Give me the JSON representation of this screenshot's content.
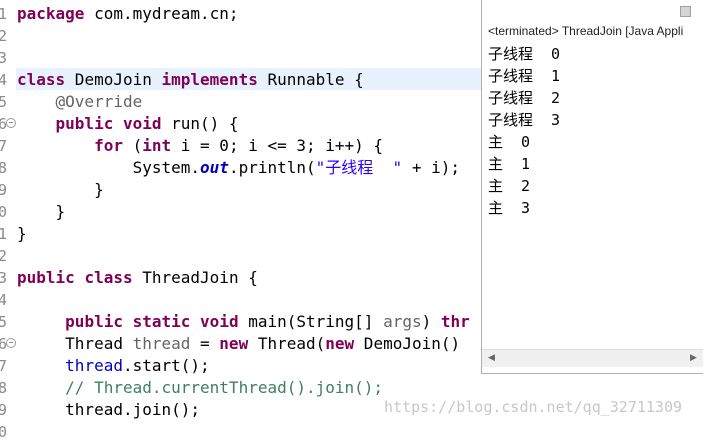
{
  "editor": {
    "line_numbers": [
      "1",
      "2",
      "3",
      "4",
      "5",
      "6",
      "7",
      "8",
      "9",
      "0",
      "1",
      "2",
      "3",
      "4",
      "5",
      "6",
      "7",
      "8",
      "9",
      "0"
    ],
    "lines": [
      [
        {
          "t": "package",
          "c": "kw"
        },
        {
          "t": " com.mydream.cn;",
          "c": ""
        }
      ],
      [],
      [],
      [
        {
          "t": "class",
          "c": "kw"
        },
        {
          "t": " DemoJoin ",
          "c": ""
        },
        {
          "t": "implements",
          "c": "kw"
        },
        {
          "t": " Runnable {",
          "c": ""
        }
      ],
      [
        {
          "t": "    @Override",
          "c": "ann"
        }
      ],
      [
        {
          "t": "    ",
          "c": ""
        },
        {
          "t": "public",
          "c": "kw"
        },
        {
          "t": " ",
          "c": ""
        },
        {
          "t": "void",
          "c": "kw"
        },
        {
          "t": " run() {",
          "c": ""
        }
      ],
      [
        {
          "t": "        ",
          "c": ""
        },
        {
          "t": "for",
          "c": "kw"
        },
        {
          "t": " (",
          "c": ""
        },
        {
          "t": "int",
          "c": "kw"
        },
        {
          "t": " i = 0; i <= 3; i++) {",
          "c": ""
        }
      ],
      [
        {
          "t": "            System.",
          "c": ""
        },
        {
          "t": "out",
          "c": "fld"
        },
        {
          "t": ".println(",
          "c": ""
        },
        {
          "t": "\"子线程  \"",
          "c": "str"
        },
        {
          "t": " + i);",
          "c": ""
        }
      ],
      [
        {
          "t": "        }",
          "c": ""
        }
      ],
      [
        {
          "t": "    }",
          "c": ""
        }
      ],
      [
        {
          "t": "}",
          "c": ""
        }
      ],
      [],
      [
        {
          "t": "public",
          "c": "kw"
        },
        {
          "t": " ",
          "c": ""
        },
        {
          "t": "class",
          "c": "kw"
        },
        {
          "t": " ThreadJoin {",
          "c": ""
        }
      ],
      [],
      [
        {
          "t": "     ",
          "c": ""
        },
        {
          "t": "public",
          "c": "kw"
        },
        {
          "t": " ",
          "c": ""
        },
        {
          "t": "static",
          "c": "kw"
        },
        {
          "t": " ",
          "c": ""
        },
        {
          "t": "void",
          "c": "kw"
        },
        {
          "t": " main(String[] ",
          "c": ""
        },
        {
          "t": "args",
          "c": "ann"
        },
        {
          "t": ") ",
          "c": ""
        },
        {
          "t": "thr",
          "c": "kw"
        }
      ],
      [
        {
          "t": "     Thread ",
          "c": ""
        },
        {
          "t": "thread",
          "c": "ann"
        },
        {
          "t": " = ",
          "c": ""
        },
        {
          "t": "new",
          "c": "kw"
        },
        {
          "t": " Thread(",
          "c": ""
        },
        {
          "t": "new",
          "c": "kw"
        },
        {
          "t": " DemoJoin()",
          "c": ""
        }
      ],
      [
        {
          "t": "     ",
          "c": ""
        },
        {
          "t": "thread",
          "c": "var"
        },
        {
          "t": ".start();",
          "c": ""
        }
      ],
      [
        {
          "t": "     ",
          "c": ""
        },
        {
          "t": "// Thread.currentThread().join();",
          "c": "cmt"
        }
      ],
      [
        {
          "t": "     thread.join();",
          "c": ""
        }
      ]
    ],
    "watermark": "https://blog.csdn.net/qq_32711309"
  },
  "console": {
    "title": "<terminated> ThreadJoin [Java Appli",
    "output": [
      "子线程  0",
      "子线程  1",
      "子线程  2",
      "子线程  3",
      "主  0",
      "主  1",
      "主  2",
      "主  3"
    ]
  }
}
